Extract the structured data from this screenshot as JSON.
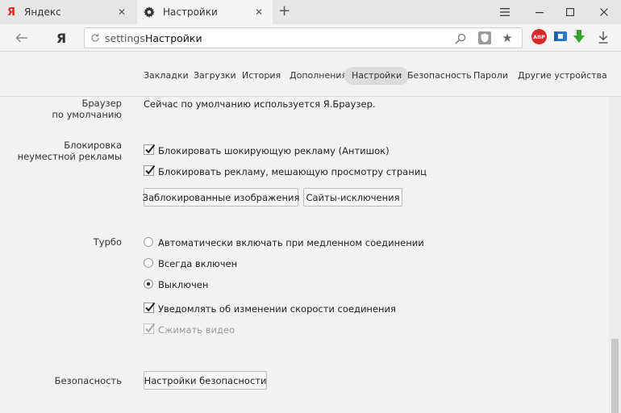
{
  "tabs": [
    {
      "title": "Яндекс",
      "icon": "yandex-logo-icon"
    },
    {
      "title": "Настройки",
      "icon": "gear-icon"
    }
  ],
  "tab_close_glyph": "✕",
  "toolbar": {
    "yandex_button": "Я",
    "url_text": "settings",
    "page_title": "Настройки"
  },
  "extensions": {
    "abp_label": "ABP"
  },
  "nav": {
    "items": [
      "Закладки",
      "Загрузки",
      "История",
      "Дополнения",
      "Настройки",
      "Безопасность",
      "Пароли",
      "Другие устройства"
    ],
    "active": "Настройки"
  },
  "sections": {
    "default_browser": {
      "label_line1": "Браузер",
      "label_line2": "по умолчанию",
      "text": "Сейчас по умолчанию используется Я.Браузер."
    },
    "ad_blocking": {
      "label_line1": "Блокировка",
      "label_line2": "неуместной рекламы",
      "options": [
        {
          "text": "Блокировать шокирующую рекламу (Антишок)",
          "checked": true
        },
        {
          "text": "Блокировать рекламу, мешающую просмотру страниц",
          "checked": true
        }
      ],
      "buttons": [
        "Заблокированные изображения",
        "Сайты-исключения"
      ]
    },
    "turbo": {
      "label": "Турбо",
      "radios": [
        {
          "text": "Автоматически включать при медленном соединении",
          "selected": false
        },
        {
          "text": "Всегда включен",
          "selected": false
        },
        {
          "text": "Выключен",
          "selected": true
        }
      ],
      "checks": [
        {
          "text": "Уведомлять об изменении скорости соединения",
          "checked": true,
          "disabled": false
        },
        {
          "text": "Сжимать видео",
          "checked": true,
          "disabled": true
        }
      ]
    },
    "security": {
      "label": "Безопасность",
      "button": "Настройки безопасности"
    }
  }
}
